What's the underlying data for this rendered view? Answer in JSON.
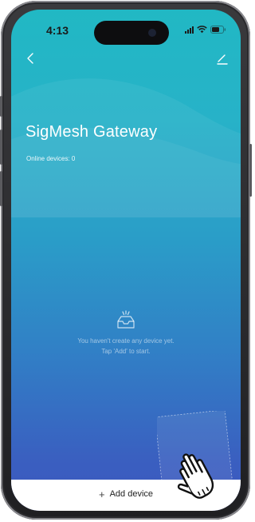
{
  "status_bar": {
    "time": "4:13",
    "signal_icon": "signal-bars-icon",
    "wifi_icon": "wifi-icon",
    "battery_icon": "battery-icon"
  },
  "nav": {
    "back_icon": "chevron-left-icon",
    "edit_icon": "edit-pencil-icon"
  },
  "header": {
    "title": "SigMesh Gateway",
    "online_devices": "Online devices: 0"
  },
  "empty_state": {
    "icon": "empty-inbox-icon",
    "line1": "You haven't create any device yet.",
    "line2": "Tap 'Add' to start."
  },
  "bottom": {
    "add_icon": "plus-icon",
    "add_label": "Add device"
  },
  "overlay": {
    "pointer_icon": "hand-pointer-icon"
  },
  "colors": {
    "gradient_top": "#21b8c4",
    "gradient_bottom": "#3d57be",
    "text_on_gradient": "#ffffff"
  }
}
